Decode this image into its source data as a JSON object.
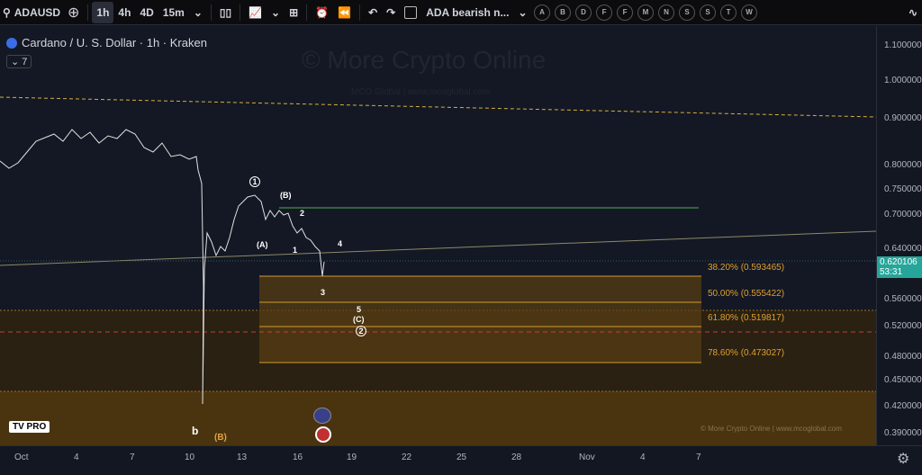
{
  "toolbar": {
    "symbol": "ADAUSD",
    "intervals": [
      "1h",
      "4h",
      "4D",
      "15m"
    ],
    "active_interval": "1h",
    "layout_name": "ADA bearish n...",
    "letters": [
      "A",
      "B",
      "D",
      "F",
      "F",
      "M",
      "N",
      "S",
      "S",
      "T",
      "W"
    ]
  },
  "legend": {
    "title": "Cardano / U. S. Dollar · 1h · Kraken",
    "indicators_count": "7"
  },
  "watermark": {
    "main": "© More Crypto Online",
    "sub": "MCO Global  |  www.mcoglobal.com",
    "footer": "© More Crypto Online  |  www.mcoglobal.com"
  },
  "price_axis": [
    "1.100000",
    "1.000000",
    "0.900000",
    "0.800000",
    "0.750000",
    "0.700000",
    "0.640000",
    "0.560000",
    "0.520000",
    "0.480000",
    "0.450000",
    "0.420000",
    "0.390000"
  ],
  "last_price": {
    "value": "0.620106",
    "countdown": "53:31",
    "color": "#26a69a"
  },
  "time_axis": [
    "Oct",
    "4",
    "7",
    "10",
    "13",
    "16",
    "19",
    "22",
    "25",
    "28",
    "Nov",
    "4",
    "7"
  ],
  "fib_levels": [
    {
      "label": "38.20% (0.593465)"
    },
    {
      "label": "50.00% (0.555422)"
    },
    {
      "label": "61.80% (0.519817)"
    },
    {
      "label": "78.60% (0.473027)"
    }
  ],
  "waves": {
    "w1c": "1",
    "B": "(B)",
    "two": "2",
    "A": "(A)",
    "one": "1",
    "four": "4",
    "three": "3",
    "five": "5",
    "C": "(C)",
    "w2c": "2",
    "b": "b",
    "Bb": "(B)"
  },
  "logo": "TV PRO"
}
